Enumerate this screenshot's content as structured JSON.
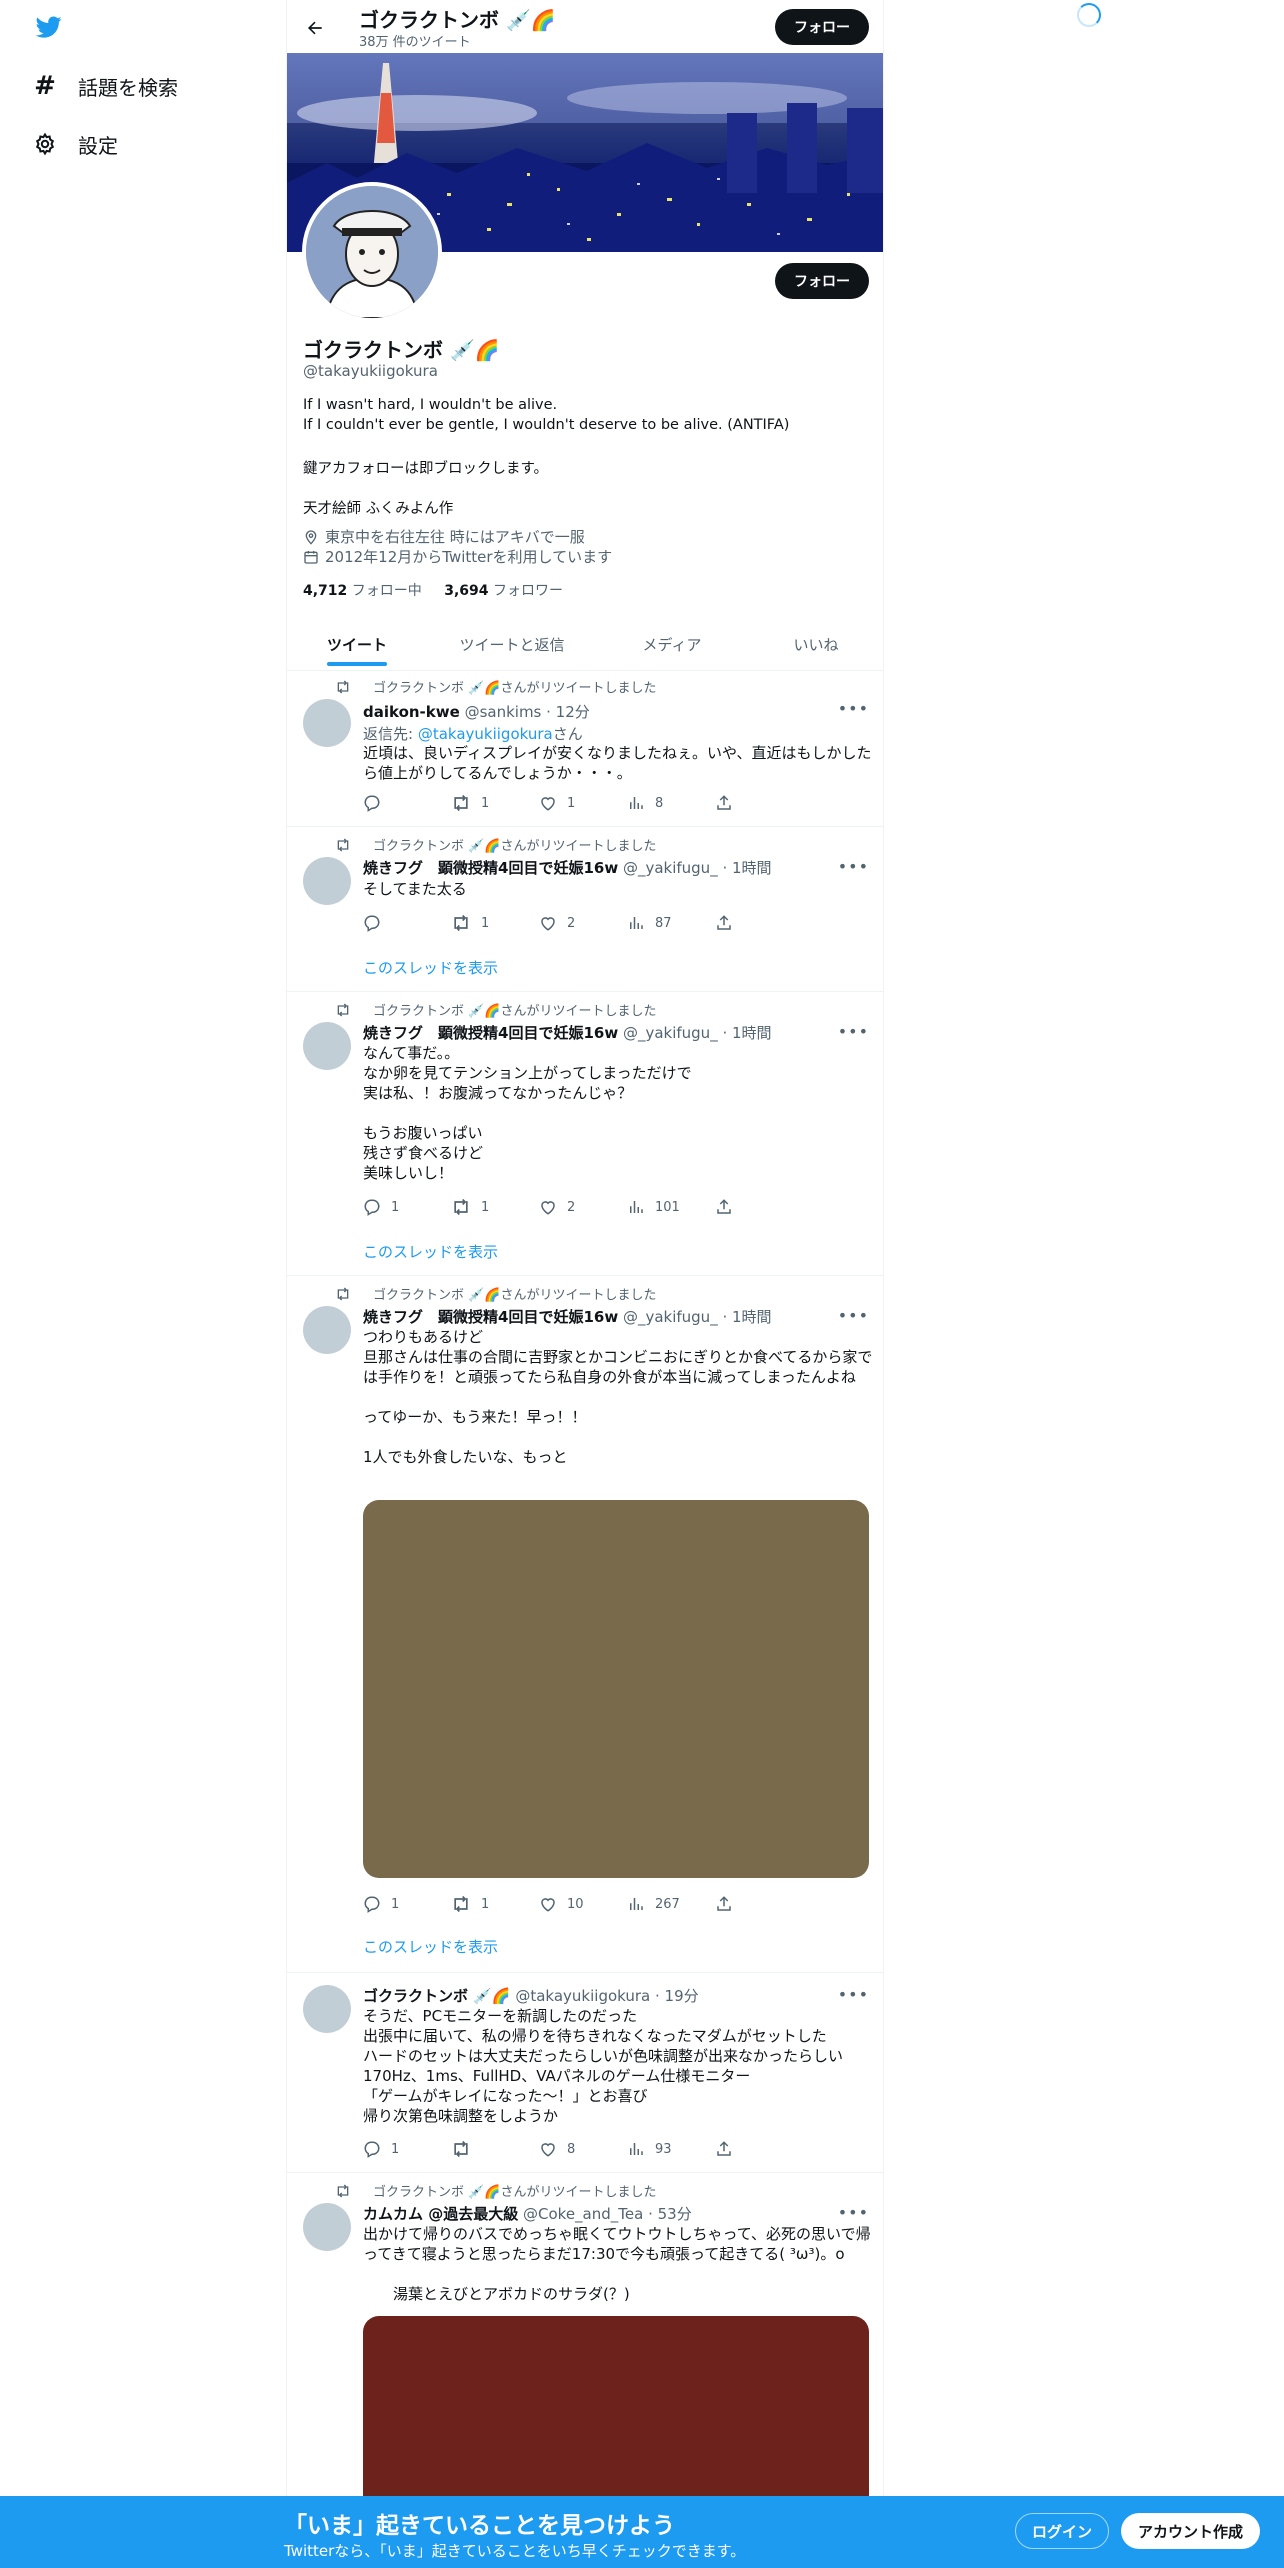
{
  "nav": {
    "explore_label": "話題を検索",
    "settings_label": "設定"
  },
  "header": {
    "name": "ゴクラクトンボ 💉🌈",
    "tweet_count": "38万 件のツイート",
    "follow_label": "フォロー"
  },
  "profile": {
    "name": "ゴクラクトンボ 💉🌈",
    "handle": "@takayukiigokura",
    "follow_label": "フォロー",
    "bio_lines": [
      "If I wasn't hard, I wouldn't be alive.",
      "If I couldn't ever be gentle, I wouldn't deserve to be alive. (ANTIFA)",
      "鍵アカフォローは即ブロックします。",
      "天才絵師 ふくみよん作"
    ],
    "location": "東京中を右往左往 時にはアキバで一服",
    "joined": "2012年12月からTwitterを利用しています",
    "following_count": "4,712",
    "following_label": "フォロー中",
    "followers_count": "3,694",
    "followers_label": "フォロワー"
  },
  "tabs": [
    "ツイート",
    "ツイートと返信",
    "メディア",
    "いいね"
  ],
  "retweet_label": "ゴクラクトンボ 💉🌈さんがリツイートしました",
  "thread_label": "このスレッドを表示",
  "tweets": [
    {
      "name": "daikon-kwe",
      "meta": "@sankims · 12分",
      "reply_prefix": "返信先: ",
      "reply_handle": "@takayukiigokura",
      "reply_suffix": "さん",
      "text": "近頃は、良いディスプレイが安くなりましたねぇ。いや、直近はもしかしたら値上がりしてるんでしょうか・・・。",
      "replies": "",
      "retweets": "1",
      "likes": "1",
      "views": "8"
    },
    {
      "name": "焼きフグ　顕微授精4回目で妊娠16w",
      "meta": "@_yakifugu_ · 1時間",
      "text": "そしてまた太る",
      "replies": "",
      "retweets": "1",
      "likes": "2",
      "views": "87"
    },
    {
      "name": "焼きフグ　顕微授精4回目で妊娠16w",
      "meta": "@_yakifugu_ · 1時間",
      "text": "なんて事だ。。\nなか卵を見てテンション上がってしまっただけで\n実は私、！お腹減ってなかったんじゃ？\n\nもうお腹いっぱい\n残さず食べるけど\n美味しいし！",
      "replies": "1",
      "retweets": "1",
      "likes": "2",
      "views": "101"
    },
    {
      "name": "焼きフグ　顕微授精4回目で妊娠16w",
      "meta": "@_yakifugu_ · 1時間",
      "text": "つわりもあるけど\n旦那さんは仕事の合間に吉野家とかコンビニおにぎりとか食べてるから家では手作りを！と頑張ってたら私自身の外食が本当に減ってしまったんよね\n\nってゆーか、もう来た！早っ！！\n\n1人でも外食したいな、もっと",
      "replies": "1",
      "retweets": "1",
      "likes": "10",
      "views": "267"
    },
    {
      "name": "ゴクラクトンボ 💉🌈",
      "meta": "@takayukiigokura · 19分",
      "text": "そうだ、PCモニターを新調したのだった\n出張中に届いて、私の帰りを待ちきれなくなったマダムがセットした\nハードのセットは大丈夫だったらしいが色味調整が出来なかったらしい\n170Hz、1ms、FullHD、VAパネルのゲーム仕様モニター\n「ゲームがキレイになった～！」とお喜び\n帰り次第色味調整をしようか",
      "replies": "1",
      "retweets": "",
      "likes": "8",
      "views": "93"
    },
    {
      "name": "カムカム @過去最大級",
      "meta": "@Coke_and_Tea · 53分",
      "text": "出かけて帰りのバスでめっちゃ眠くてウトウトしちゃって、必死の思いで帰ってきて寝ようと思ったらまだ17:30で今も頑張って起きてる( ³ω³)。o\n\n　　湯葉とえびとアボカドのサラダ(？)"
    }
  ],
  "media_colors": [
    "#786a4a",
    "#6e221c"
  ],
  "bottom_bar": {
    "title": "「いま」起きていることを見つけよう",
    "subtitle": "Twitterなら、「いま」起きていることをいち早くチェックできます。",
    "login_label": "ログイン",
    "signup_label": "アカウント作成"
  },
  "colors": {
    "accent": "#1d9bf0",
    "text": "#0f1419",
    "secondary": "#536471"
  }
}
